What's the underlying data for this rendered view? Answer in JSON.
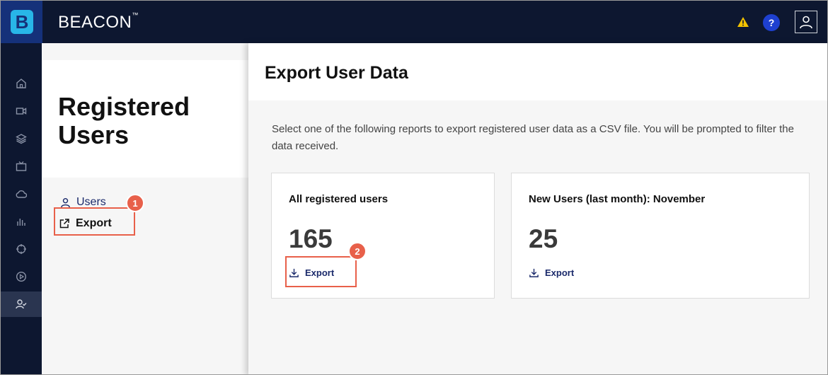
{
  "app": {
    "brand": "BEACON",
    "trademark": "™",
    "logo_letter": "B"
  },
  "colors": {
    "accent": "#1b2a6b",
    "callout": "#e8604a",
    "topbar": "#0d1730",
    "help": "#1e40d0",
    "warn": "#f2c200"
  },
  "header_icons": [
    "warning-icon",
    "help-icon",
    "user-icon"
  ],
  "help_label": "?",
  "sidebar": {
    "icons": [
      "home-icon",
      "video-icon",
      "layers-icon",
      "tv-icon",
      "cloud-icon",
      "bar-chart-icon",
      "target-icon",
      "play-circle-icon",
      "user-check-icon"
    ]
  },
  "page": {
    "title": "Registered Users"
  },
  "subnav": {
    "users_label": "Users",
    "export_label": "Export"
  },
  "callouts": {
    "one": "1",
    "two": "2"
  },
  "drawer": {
    "title": "Export User Data",
    "description": "Select one of the following reports to export registered user data as a CSV file. You will be prompted to filter the data received.",
    "cards": [
      {
        "title": "All registered users",
        "count": "165",
        "export_label": "Export"
      },
      {
        "title": "New Users (last month): November",
        "count": "25",
        "export_label": "Export"
      }
    ]
  }
}
